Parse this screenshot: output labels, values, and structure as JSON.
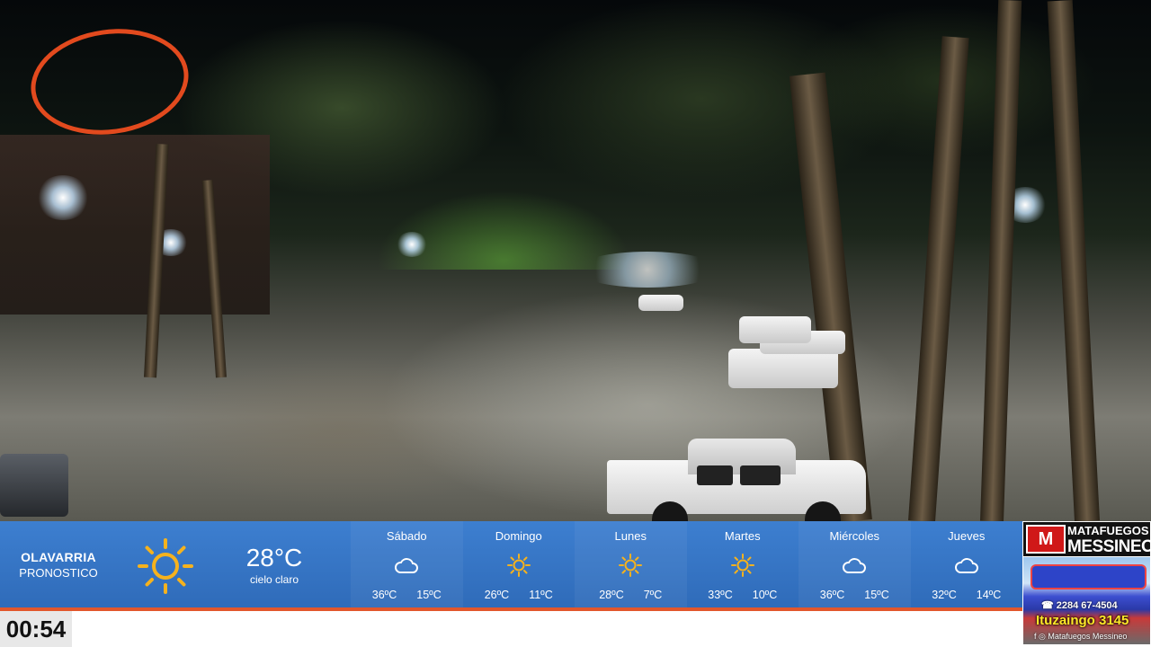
{
  "weather": {
    "city": "OLAVARRIA",
    "subtitle": "PRONOSTICO",
    "current_icon": "sun-icon",
    "current_temp": "28°C",
    "current_desc": "cielo claro",
    "days": [
      {
        "name": "Sábado",
        "icon": "cloud-icon",
        "max": "36ºC",
        "min": "15ºC"
      },
      {
        "name": "Domingo",
        "icon": "sun-icon",
        "max": "26ºC",
        "min": "11ºC"
      },
      {
        "name": "Lunes",
        "icon": "sun-icon",
        "max": "28ºC",
        "min": "7ºC"
      },
      {
        "name": "Martes",
        "icon": "sun-icon",
        "max": "33ºC",
        "min": "10ºC"
      },
      {
        "name": "Miércoles",
        "icon": "cloud-icon",
        "max": "36ºC",
        "min": "15ºC"
      },
      {
        "name": "Jueves",
        "icon": "cloud-icon",
        "max": "32ºC",
        "min": "14ºC"
      }
    ]
  },
  "ad": {
    "line1": "MATAFUEGOS",
    "line2": "MESSINEO",
    "phone": "2284 67-4504",
    "address": "Ituzaingo 3145",
    "social": "Matafuegos Messineo"
  },
  "clock": "00:54",
  "colors": {
    "bar": "#3d7fd0",
    "accent": "#e2572c",
    "sun": "#f5b21e"
  }
}
